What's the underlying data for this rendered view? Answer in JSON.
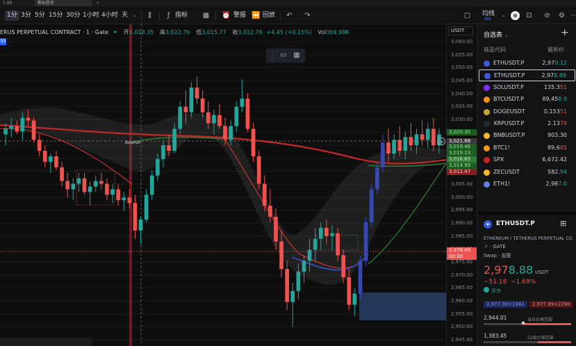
{
  "tabs": [
    {
      "label": "5.88"
    },
    {
      "label": "新标签页"
    }
  ],
  "toolbar": {
    "intervals": [
      "1分",
      "3分",
      "5分",
      "15分",
      "30分",
      "1小时",
      "4小时",
      "天"
    ],
    "active_interval": "1分",
    "indicators_label": "指标",
    "alert_label": "警报",
    "replay_label": "回放",
    "ma_label": "均线",
    "ma_sub": "神级"
  },
  "legend": {
    "symbol": "ERUS PERPETUAL CONTRACT · 1 · Gate",
    "open_label": "开",
    "open": "3,018.35",
    "high_label": "高",
    "high": "3,022.76",
    "low_label": "低",
    "low": "3,015.77",
    "close_label": "收",
    "close": "3,022.76",
    "change": "+4.45 (+0.15%)",
    "vol_label": "Vol",
    "vol": "369.98K",
    "badge": "99"
  },
  "chart_annotations": {
    "bearish": "Bearish"
  },
  "price_axis": {
    "currency": "USDT",
    "ticks": [
      "3,060.00",
      "3,055.00",
      "3,050.00",
      "3,045.00",
      "3,040.00",
      "3,035.00",
      "3,030.00",
      "3,025.00",
      "3,020.00",
      "3,015.00",
      "3,010.00",
      "3,005.00",
      "3,000.00",
      "2,995.00",
      "2,990.00",
      "2,985.00",
      "2,980.00",
      "2,975.00",
      "2,970.00",
      "2,965.00",
      "2,960.00",
      "2,955.00",
      "2,950.00",
      "2,945.00"
    ],
    "crosshair_price": "3,021.68",
    "current_price": "2,978.88",
    "countdown": "00:30",
    "green_labels": [
      "3,020.30",
      "3,019.46",
      "3,019.13",
      "3,016.65",
      "3,014.99"
    ],
    "red_label": "3,012.47"
  },
  "watchlist": {
    "title": "自选表",
    "col_symbol": "商品代码",
    "col_price": "最新价",
    "rows": [
      {
        "symbol": "ETHUSDT.P",
        "price_main": "2,97",
        "price_tail": "9.12",
        "tail_color": "up",
        "icon_color": "#3b5bdb"
      },
      {
        "symbol": "ETHUSDT.P",
        "price_main": "2,97",
        "price_tail": "8.88",
        "tail_color": "up",
        "icon_color": "#3b5bdb",
        "selected": true
      },
      {
        "symbol": "SOLUSDT.P",
        "price_main": "135.3",
        "price_tail": "51",
        "tail_color": "down",
        "icon_color": "#7b2ff7"
      },
      {
        "symbol": "BTCUSDT.P",
        "price_main": "89,45",
        "price_tail": "8.9",
        "tail_color": "up",
        "icon_color": "#f7931a"
      },
      {
        "symbol": "DOGEUSDT",
        "price_main": "0.153",
        "price_tail": "51",
        "tail_color": "down",
        "icon_color": "#c2a633"
      },
      {
        "symbol": "XRPUSDT.P",
        "price_main": "2.13",
        "price_tail": "79",
        "tail_color": "down",
        "icon_color": "#23292f"
      },
      {
        "symbol": "BNBUSDT.P",
        "price_main": "903.",
        "price_tail": "30",
        "tail_color": "none",
        "icon_color": "#f3ba2f"
      },
      {
        "symbol": "BTC1!",
        "price_main": "89,6",
        "price_tail": "85",
        "tail_color": "down",
        "icon_color": "#f7931a"
      },
      {
        "symbol": "SPX",
        "price_main": "6,672.",
        "price_tail": "42",
        "tail_color": "none",
        "icon_color": "#c62828"
      },
      {
        "symbol": "ZECUSDT",
        "price_main": "582.",
        "price_tail": "94",
        "tail_color": "up",
        "icon_color": "#f4b728"
      },
      {
        "symbol": "ETH1!",
        "price_main": "2,98",
        "price_tail": "7.0",
        "tail_color": "up",
        "icon_color": "#627eea"
      }
    ]
  },
  "detail": {
    "symbol": "ETHUSDT.P",
    "name": "ETHEREUM / TETHERUS PERPETUAL CO",
    "exchange": "GATE",
    "type_label": "Swap · 加密",
    "price_main": "2,97",
    "price_hl": "8.88",
    "price_unit": "USDT",
    "change": "−51.18",
    "change_pct": "−1.69%",
    "market_status": "开市",
    "bid": "2,977.98×1961",
    "ask": "2,977.99×2290",
    "day_low": "2,944.01",
    "day_range_label": "当日价格范围",
    "low_52": "1,383.45",
    "range_52_label": "52周价格范围"
  },
  "colors": {
    "up": "#26a69a",
    "down": "#ef5350",
    "accent": "#2962ff"
  },
  "chart_data": {
    "type": "candlestick",
    "interval": "1分",
    "currency": "USDT",
    "ylim": [
      2945,
      3062
    ],
    "candles": [
      [
        3022,
        3026,
        3018,
        3024
      ],
      [
        3024,
        3028,
        3021,
        3025
      ],
      [
        3025,
        3027,
        3022,
        3023
      ],
      [
        3023,
        3030,
        3020,
        3028
      ],
      [
        3028,
        3031,
        3025,
        3027
      ],
      [
        3027,
        3028,
        3019,
        3020
      ],
      [
        3020,
        3022,
        3014,
        3016
      ],
      [
        3016,
        3018,
        3010,
        3012
      ],
      [
        3012,
        3015,
        3008,
        3014
      ],
      [
        3014,
        3016,
        3009,
        3010
      ],
      [
        3010,
        3012,
        3003,
        3005
      ],
      [
        3005,
        3008,
        2999,
        3002
      ],
      [
        3002,
        3006,
        2998,
        3004
      ],
      [
        3004,
        3008,
        3001,
        3006
      ],
      [
        3006,
        3008,
        3000,
        3001
      ],
      [
        3001,
        3005,
        2996,
        3003
      ],
      [
        3003,
        3007,
        3001,
        3005
      ],
      [
        3005,
        3008,
        3002,
        3004
      ],
      [
        3004,
        3006,
        2998,
        3000
      ],
      [
        3000,
        3004,
        2997,
        3002
      ],
      [
        3002,
        3004,
        2996,
        2998
      ],
      [
        2998,
        3001,
        2994,
        2999
      ],
      [
        2999,
        3002,
        2995,
        2997
      ],
      [
        2997,
        3000,
        2984,
        2987
      ],
      [
        2987,
        2992,
        2982,
        2991
      ],
      [
        2991,
        3002,
        2990,
        3000
      ],
      [
        3000,
        3009,
        2998,
        3007
      ],
      [
        3007,
        3015,
        3005,
        3013
      ],
      [
        3013,
        3020,
        3010,
        3018
      ],
      [
        3018,
        3022,
        3014,
        3016
      ],
      [
        3016,
        3026,
        3015,
        3024
      ],
      [
        3024,
        3034,
        3022,
        3032
      ],
      [
        3032,
        3038,
        3026,
        3030
      ],
      [
        3030,
        3041,
        3028,
        3039
      ],
      [
        3039,
        3043,
        3033,
        3035
      ],
      [
        3035,
        3038,
        3028,
        3030
      ],
      [
        3030,
        3034,
        3024,
        3026
      ],
      [
        3026,
        3031,
        3022,
        3029
      ],
      [
        3029,
        3033,
        3024,
        3025
      ],
      [
        3025,
        3028,
        3018,
        3020
      ],
      [
        3020,
        3027,
        3018,
        3025
      ],
      [
        3025,
        3034,
        3023,
        3032
      ],
      [
        3032,
        3042,
        3030,
        3035
      ],
      [
        3035,
        3037,
        3023,
        3024
      ],
      [
        3024,
        3026,
        3012,
        3014
      ],
      [
        3014,
        3016,
        3002,
        3004
      ],
      [
        3004,
        3007,
        2994,
        2996
      ],
      [
        2996,
        3002,
        2990,
        2992
      ],
      [
        2992,
        2995,
        2980,
        2983
      ],
      [
        2983,
        2987,
        2970,
        2973
      ],
      [
        2973,
        2976,
        2958,
        2961
      ],
      [
        2961,
        2968,
        2952,
        2965
      ],
      [
        2965,
        2975,
        2962,
        2972
      ],
      [
        2972,
        2978,
        2968,
        2976
      ],
      [
        2976,
        2984,
        2972,
        2980
      ],
      [
        2980,
        2988,
        2976,
        2984
      ],
      [
        2984,
        2990,
        2980,
        2988
      ],
      [
        2988,
        2991,
        2982,
        2985
      ],
      [
        2985,
        2989,
        2980,
        2986
      ],
      [
        2986,
        2988,
        2976,
        2978
      ],
      [
        2978,
        2980,
        2968,
        2970
      ],
      [
        2970,
        2973,
        2958,
        2960
      ],
      [
        2960,
        2966,
        2956,
        2964
      ],
      [
        2964,
        2978,
        2962,
        2976
      ],
      [
        2976,
        2992,
        2974,
        2990
      ],
      [
        2990,
        3004,
        2988,
        3002
      ],
      [
        3002,
        3012,
        3000,
        3010
      ],
      [
        3010,
        3022,
        3008,
        3019
      ],
      [
        3019,
        3024,
        3012,
        3015
      ],
      [
        3015,
        3022,
        3013,
        3020
      ],
      [
        3020,
        3025,
        3014,
        3016
      ],
      [
        3016,
        3023,
        3013,
        3021
      ],
      [
        3021,
        3026,
        3016,
        3018
      ],
      [
        3018,
        3024,
        3015,
        3022
      ],
      [
        3022,
        3027,
        3018,
        3020
      ],
      [
        3020,
        3026,
        3017,
        3024
      ],
      [
        3024,
        3028,
        3016,
        3018
      ],
      [
        3018,
        3024,
        3015,
        3022
      ]
    ]
  }
}
